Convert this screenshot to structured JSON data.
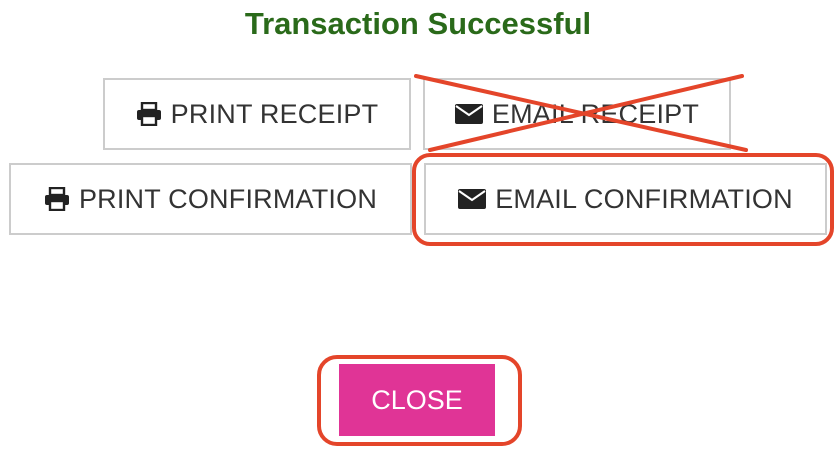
{
  "dialog": {
    "title": "Transaction Successful"
  },
  "buttons": {
    "print_receipt": "PRINT RECEIPT",
    "email_receipt": "EMAIL RECEIPT",
    "print_confirmation": "PRINT CONFIRMATION",
    "email_confirmation": "EMAIL CONFIRMATION",
    "close": "CLOSE"
  },
  "icons": {
    "print": "printer-icon",
    "email": "envelope-icon"
  },
  "colors": {
    "title": "#2a6a1a",
    "close_button": "#e03496",
    "annotation": "#e4452a",
    "button_border": "#cccccc",
    "button_text": "#333333"
  }
}
